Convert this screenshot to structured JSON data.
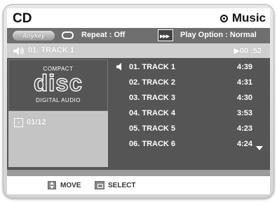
{
  "header": {
    "title": "CD",
    "mode_label": "Music"
  },
  "options": {
    "anykey_label": "Anykey",
    "repeat_text": "Repeat : Off",
    "play_option_text": "Play Option : Normal"
  },
  "now_playing": {
    "track": "01. TRACK 1",
    "time": "▶00 :52"
  },
  "disc_logo": {
    "top_text": "COMPACT",
    "main_text": "disc",
    "bottom_text": "DIGITAL AUDIO"
  },
  "counter": {
    "value": "01/12"
  },
  "tracks": [
    {
      "name": "01. TRACK 1",
      "time": "4:39",
      "playing": true
    },
    {
      "name": "02. TRACK 2",
      "time": "4:31",
      "playing": false
    },
    {
      "name": "03. TRACK 3",
      "time": "4:30",
      "playing": false
    },
    {
      "name": "04. TRACK 4",
      "time": "3:53",
      "playing": false
    },
    {
      "name": "05. TRACK 5",
      "time": "4:23",
      "playing": false
    },
    {
      "name": "06. TRACK 6",
      "time": "4:24",
      "playing": false
    }
  ],
  "hints": {
    "move_label": "MOVE",
    "select_label": "SELECT"
  },
  "colors": {
    "panel_dark": "#555555",
    "panel_light": "#c9c9c9",
    "option_bar": "#6f6f6f",
    "text_light": "#ffffff"
  }
}
